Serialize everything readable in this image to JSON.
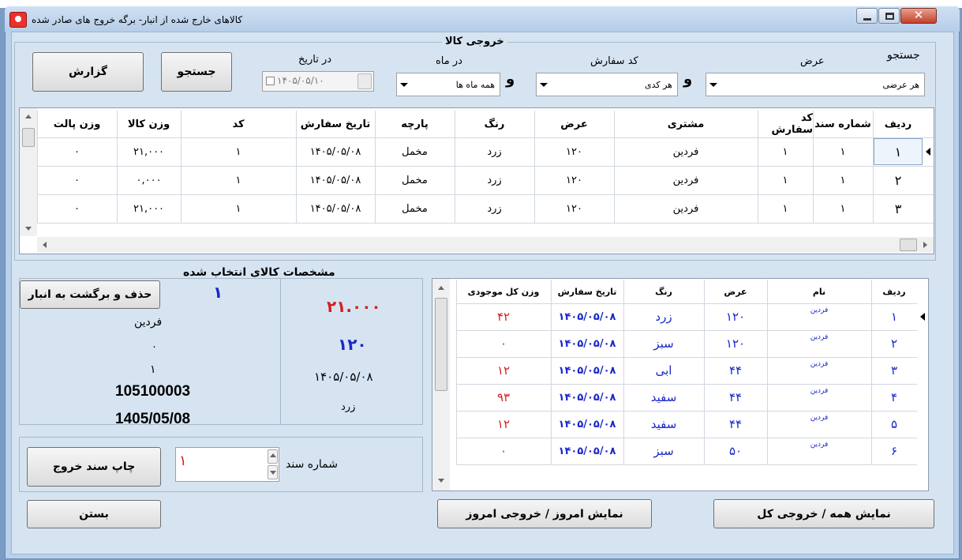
{
  "window": {
    "title": "کالاهای خارج شده از انبار- برگه خروج  های صادر شده"
  },
  "main_group": {
    "title": "خروجی کالا"
  },
  "search": {
    "label": "جستجو",
    "width_label": "عرض",
    "width_value": "هر عرضی",
    "and1": "و",
    "order_code_label": "کد سفارش",
    "order_code_value": "هر کدی",
    "and2": "و",
    "month_label": "در ماه",
    "month_value": "همه ماه ها",
    "date_label": "در تاریخ",
    "date_value": "۱۴۰۵/۰۵/۱۰",
    "search_button": "جستجو",
    "report_button": "گزارش"
  },
  "top_grid": {
    "columns": [
      "ردیف",
      "شماره سند",
      "کد سفارش",
      "مشتری",
      "عرض",
      "رنگ",
      "پارچه",
      "تاریخ سفارش",
      "کد",
      "وزن کالا",
      "وزن پالت"
    ],
    "rows": [
      [
        "۱",
        "۱",
        "۱",
        "فردین",
        "۱۲۰",
        "زرد",
        "مخمل",
        "۱۴۰۵/۰۵/۰۸",
        "۱",
        "۲۱,۰۰۰",
        "۰"
      ],
      [
        "۲",
        "۱",
        "۱",
        "فردین",
        "۱۲۰",
        "زرد",
        "مخمل",
        "۱۴۰۵/۰۵/۰۸",
        "۱",
        "۰,۰۰۰",
        "۰"
      ],
      [
        "۳",
        "۱",
        "۱",
        "فردین",
        "۱۲۰",
        "زرد",
        "مخمل",
        "۱۴۰۵/۰۵/۰۸",
        "۱",
        "۲۱,۰۰۰",
        "۰"
      ]
    ]
  },
  "details": {
    "title": "مشخصات کالای انتخاب شده",
    "delete_button": "حذف و برگشت به انبار",
    "sel_row": "۱",
    "customer": "فردین",
    "pallet_weight": "۰",
    "code": "۱",
    "barcode": "105100003",
    "date_latin": "1405/05/08",
    "weight": "۲۱.۰۰۰",
    "width": "۱۲۰",
    "order_date": "۱۴۰۵/۰۵/۰۸",
    "color": "زرد"
  },
  "doc": {
    "print_button": "چاپ سند خروج",
    "number_label": "شماره سند",
    "number_value": "۱"
  },
  "inventory_grid": {
    "columns": [
      "ردیف",
      "نام",
      "عرض",
      "رنگ",
      "تاریخ سفارش",
      "وزن کل موجودی"
    ],
    "rows": [
      [
        "۱",
        "فردین",
        "۱۲۰",
        "زرد",
        "۱۴۰۵/۰۵/۰۸",
        "۴۲"
      ],
      [
        "۲",
        "فردین",
        "۱۲۰",
        "سبز",
        "۱۴۰۵/۰۵/۰۸",
        "۰"
      ],
      [
        "۳",
        "فردین",
        "۴۴",
        "ابی",
        "۱۴۰۵/۰۵/۰۸",
        "۱۲"
      ],
      [
        "۴",
        "فردین",
        "۴۴",
        "سفید",
        "۱۴۰۵/۰۵/۰۸",
        "۹۳"
      ],
      [
        "۵",
        "فردین",
        "۴۴",
        "سفید",
        "۱۴۰۵/۰۵/۰۸",
        "۱۲"
      ],
      [
        "۶",
        "فردین",
        "۵۰",
        "سبز",
        "۱۴۰۵/۰۵/۰۸",
        "۰"
      ]
    ]
  },
  "bottom": {
    "close_button": "بستن",
    "today_button": "نمایش امروز / خروجی امروز",
    "all_button": "نمایش همه / خروجی کل"
  },
  "colors": {
    "accent_red": "#d42020",
    "accent_blue": "#1a28c8",
    "window_bg": "#d6e4f2"
  },
  "icons": [
    "app-icon",
    "minimize-icon",
    "maximize-icon",
    "close-icon",
    "dropdown-arrow-icon",
    "row-pointer-icon",
    "scroll-up-icon",
    "scroll-down-icon",
    "scroll-left-icon",
    "scroll-right-icon"
  ]
}
